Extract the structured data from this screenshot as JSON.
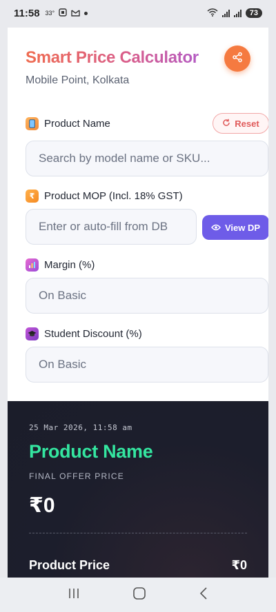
{
  "status_bar": {
    "time": "11:58",
    "temperature": "33°",
    "battery": "73"
  },
  "header": {
    "title": "Smart Price Calculator",
    "subtitle": "Mobile Point, Kolkata"
  },
  "fields": {
    "product_name": {
      "label": "Product Name",
      "placeholder": "Search by model name or SKU..."
    },
    "product_mop": {
      "label": "Product MOP (Incl. 18% GST)",
      "placeholder": "Enter or auto-fill from DB"
    },
    "margin": {
      "label": "Margin (%)",
      "placeholder": "On Basic"
    },
    "student_discount": {
      "label": "Student Discount (%)",
      "placeholder": "On Basic"
    }
  },
  "buttons": {
    "reset": "Reset",
    "view_dp": "View DP"
  },
  "receipt": {
    "datetime": "25 Mar 2026, 11:58 am",
    "product_name": "Product Name",
    "final_offer_label": "FINAL OFFER PRICE",
    "final_offer_value": "₹0",
    "rows": [
      {
        "label": "Product Price",
        "value": "₹0"
      }
    ]
  },
  "icons": {
    "share": "share-icon",
    "reset": "refresh-icon",
    "view_dp": "eye-icon",
    "product_name": "phone-icon",
    "product_mop": "rupee-icon",
    "margin": "bar-chart-icon",
    "student_discount": "graduation-cap-icon"
  },
  "colors": {
    "accent_orange": "#f57a40",
    "accent_purple": "#6e5ce8",
    "reset_red": "#e05a5a",
    "offer_green": "#34e6a0",
    "receipt_bg": "#1c1e2c"
  }
}
